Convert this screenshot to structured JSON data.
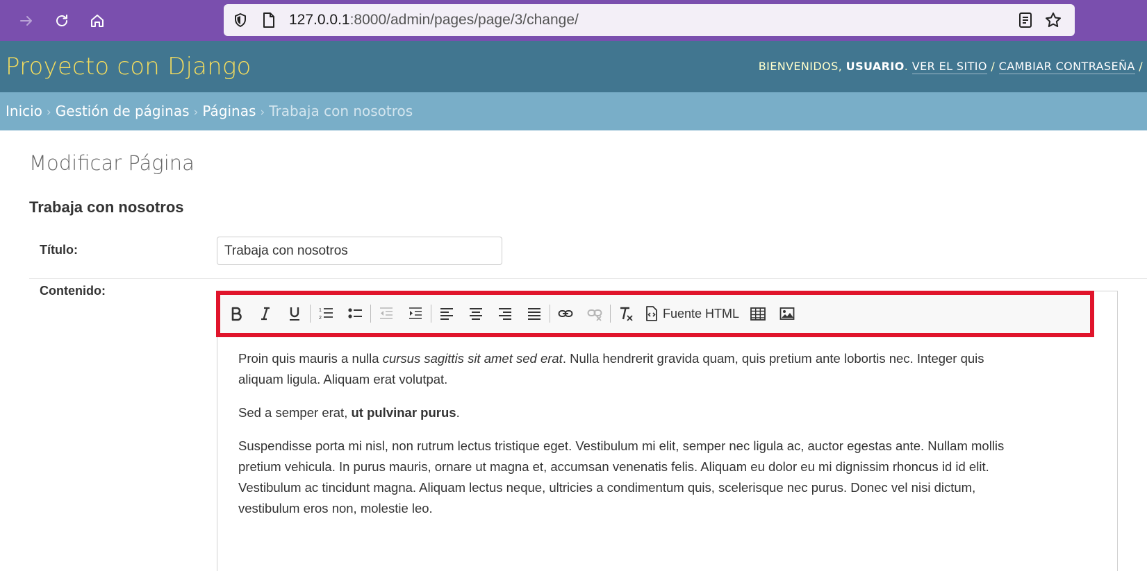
{
  "browser": {
    "url_host": "127.0.0.1",
    "url_path": ":8000/admin/pages/page/3/change/",
    "icons": [
      "forward-icon",
      "reload-icon",
      "home-icon",
      "shield-icon",
      "page-icon",
      "reader-view-icon",
      "bookmark-star-icon"
    ]
  },
  "header": {
    "site_name": "Proyecto con Django",
    "welcome": "Bienvenidos, ",
    "username": "Usuario",
    "view_site": "Ver el sitio",
    "change_password": "Cambiar contraseña",
    "slash": " / "
  },
  "breadcrumbs": {
    "home": "Inicio",
    "app": "Gestión de páginas",
    "model": "Páginas",
    "current": "Trabaja con nosotros",
    "separator": "›"
  },
  "content": {
    "page_title": "Modificar Página",
    "object_title": "Trabaja con nosotros",
    "title_label": "Título:",
    "title_value": "Trabaja con nosotros",
    "content_label": "Contenido:"
  },
  "editor": {
    "source_label": "Fuente HTML",
    "p1_a": "Proin quis mauris a nulla ",
    "p1_em": "cursus sagittis sit amet sed erat",
    "p1_b": ". Nulla hendrerit gravida quam, quis pretium ante lobortis nec. Integer quis aliquam ligula. Aliquam erat volutpat.",
    "p2_a": "Sed a semper erat, ",
    "p2_strong": "ut pulvinar purus",
    "p2_b": ".",
    "p3": "Suspendisse porta mi nisl, non rutrum lectus tristique eget. Vestibulum mi elit, semper nec ligula ac, auctor egestas ante. Nullam mollis pretium vehicula. In purus mauris, ornare ut magna et, accumsan venenatis felis. Aliquam eu dolor eu mi dignissim rhoncus id id elit. Vestibulum ac tincidunt magna. Aliquam lectus neque, ultricies a condimentum quis, scelerisque nec purus. Donec vel nisi dictum, vestibulum eros non, molestie leo."
  },
  "colors": {
    "browser_bar": "#7a4fae",
    "header": "#417690",
    "breadcrumbs": "#79aec8",
    "site_name": "#f5dd5d",
    "highlight": "#e0142b"
  }
}
